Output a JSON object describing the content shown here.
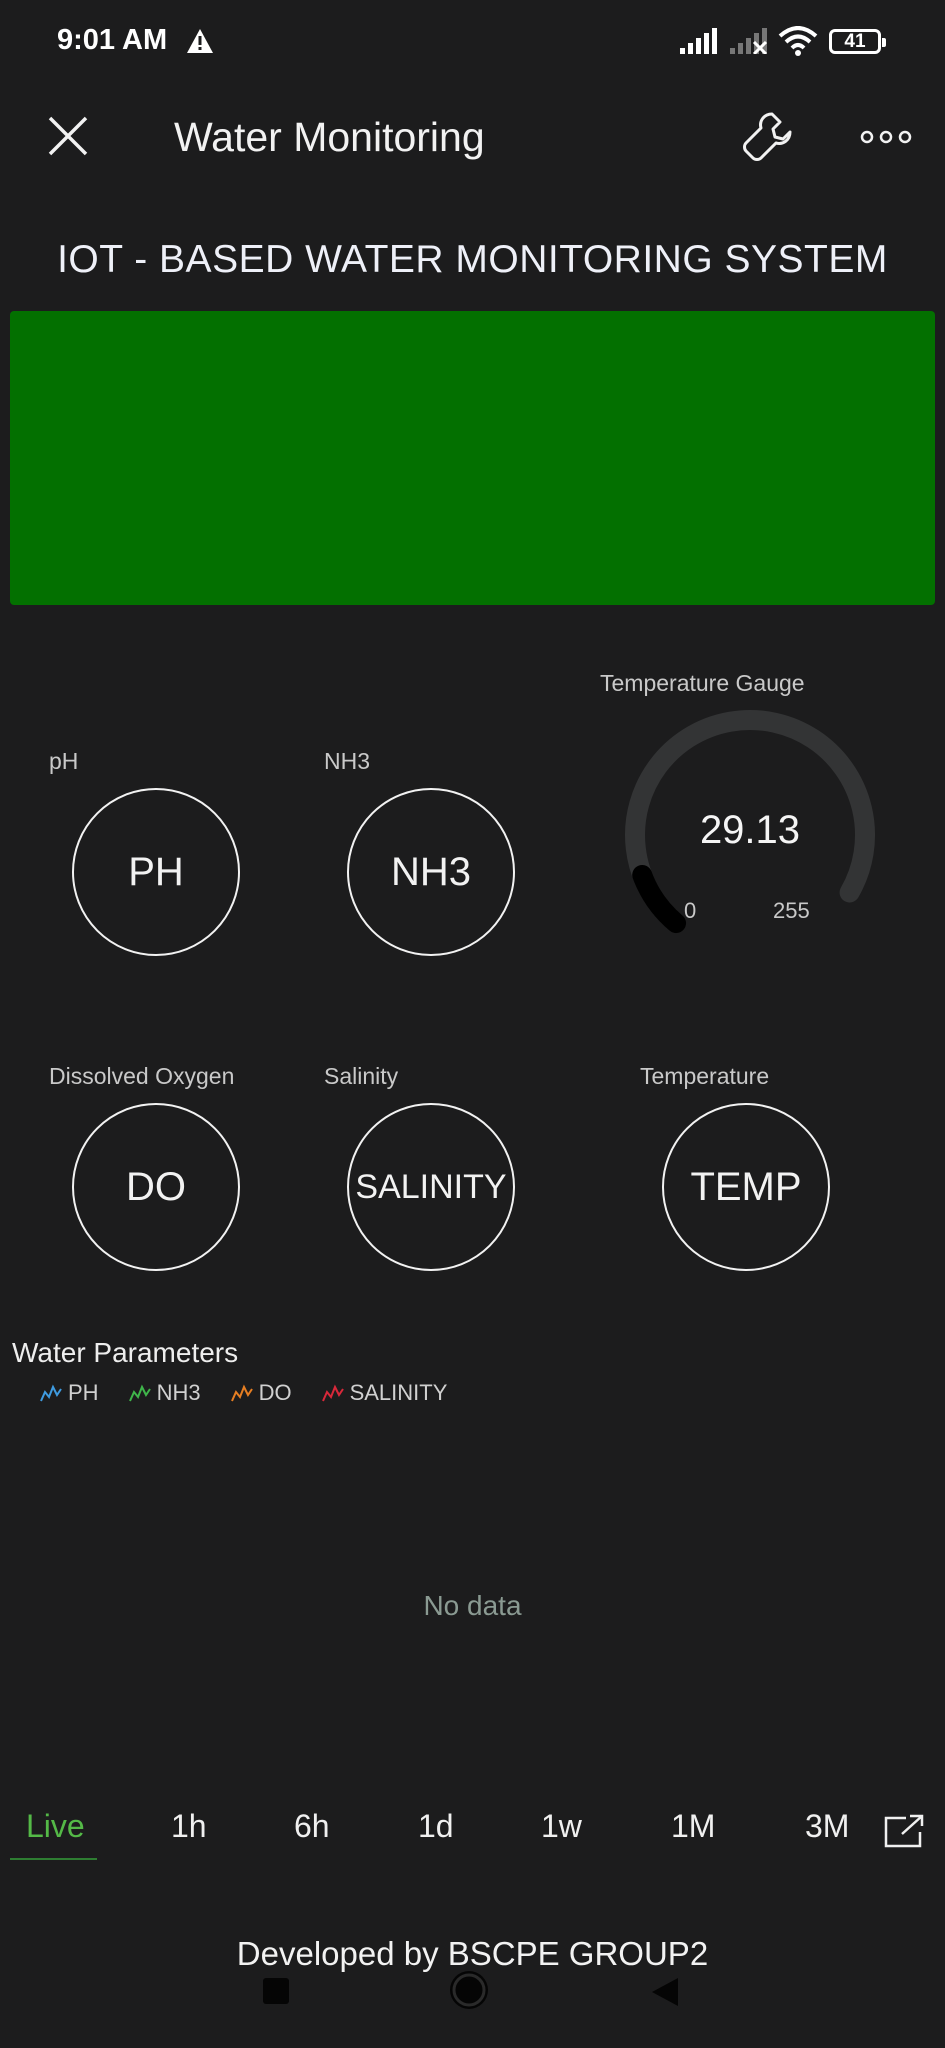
{
  "status_bar": {
    "time": "9:01 AM",
    "battery": "41",
    "icons": [
      "warning-icon",
      "signal-icon",
      "signal-off-icon",
      "wifi-icon",
      "battery-icon"
    ]
  },
  "app_bar": {
    "title": "Water Monitoring",
    "icons": [
      "close-icon",
      "wrench-icon",
      "more-icon"
    ]
  },
  "dashboard": {
    "title": "IOT - BASED WATER MONITORING SYSTEM",
    "panel_color": "#037000",
    "widgets": {
      "ph": {
        "label": "pH",
        "value": "PH"
      },
      "nh3": {
        "label": "NH3",
        "value": "NH3"
      },
      "do": {
        "label": "Dissolved Oxygen",
        "value": "DO"
      },
      "salinity": {
        "label": "Salinity",
        "value": "SALINITY"
      },
      "temperature": {
        "label": "Temperature",
        "value": "TEMP"
      }
    },
    "gauge": {
      "label": "Temperature Gauge",
      "value": "29.13",
      "min": "0",
      "max": "255",
      "fill_fraction": 0.114
    }
  },
  "chart": {
    "title": "Water Parameters",
    "empty_text": "No data",
    "legend": [
      {
        "name": "PH",
        "color": "#3f9be0"
      },
      {
        "name": "NH3",
        "color": "#3fb54a"
      },
      {
        "name": "DO",
        "color": "#e67e22"
      },
      {
        "name": "SALINITY",
        "color": "#d9283a"
      }
    ],
    "ranges": [
      "Live",
      "1h",
      "6h",
      "1d",
      "1w",
      "1M",
      "3M"
    ],
    "active_range": "Live",
    "accent_color": "#54b947"
  },
  "footer": {
    "text": "Developed by BSCPE GROUP2"
  }
}
